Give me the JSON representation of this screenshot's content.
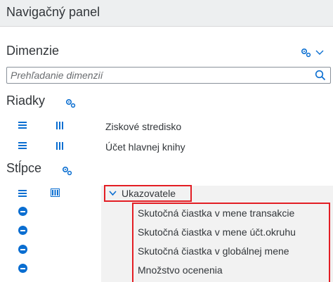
{
  "panel": {
    "title": "Navigačný panel"
  },
  "dimensions": {
    "title": "Dimenzie",
    "search": {
      "placeholder": "Prehľadanie dimenzií",
      "value": ""
    }
  },
  "rows": {
    "title": "Riadky",
    "items": [
      {
        "label": "Ziskové stredisko"
      },
      {
        "label": "Účet hlavnej knihy"
      }
    ]
  },
  "columns": {
    "title": "Stĺpce",
    "node": {
      "label": "Ukazovatele",
      "expanded": true
    },
    "measures": [
      {
        "label": "Skutočná čiastka v mene transakcie"
      },
      {
        "label": "Skutočná čiastka v mene účt.okruhu"
      },
      {
        "label": "Skutočná čiastka v globálnej mene"
      },
      {
        "label": "Množstvo ocenenia"
      }
    ]
  },
  "icons": {
    "settings": "settings-gear-icon",
    "expand": "chevron-down-icon",
    "search": "search-icon",
    "remove": "minus-circle-icon",
    "drag": "drag-handle-icon"
  },
  "colors": {
    "accent": "#0a6ed1",
    "highlight": "#e31e24",
    "header_bg": "#edeff0"
  }
}
